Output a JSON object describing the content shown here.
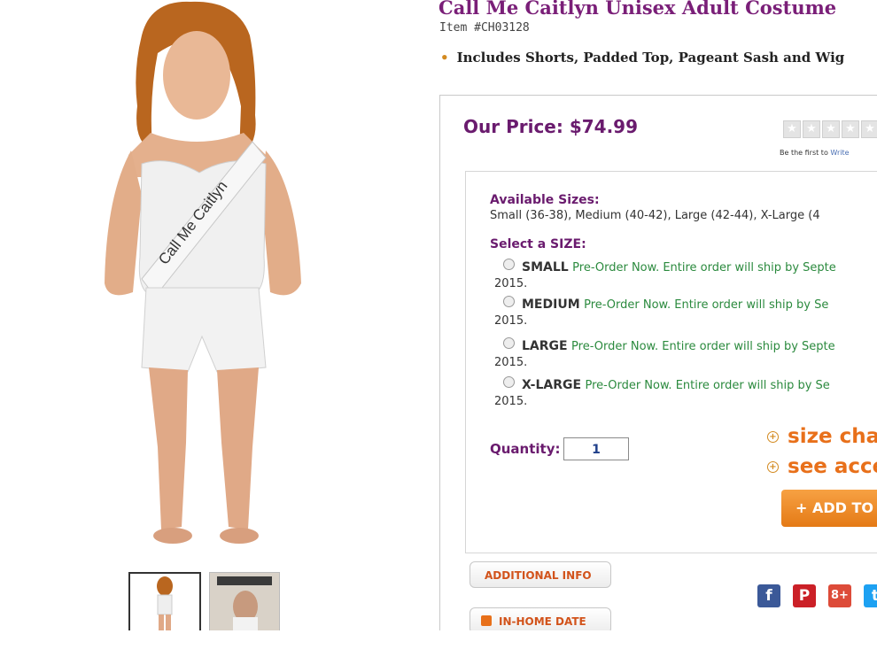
{
  "product": {
    "title": "Call Me Caitlyn Unisex Adult Costume",
    "item_number": "Item #CH03128",
    "feature": "Includes Shorts, Padded Top, Pageant Sash and Wig",
    "sash_text": "Call Me Caitlyn"
  },
  "price": {
    "label": "Our Price: $74.99"
  },
  "rating": {
    "stars": 5,
    "filled": 0,
    "review_prompt": "Be the first to",
    "review_link": "Write"
  },
  "sizes": {
    "heading": "Available Sizes:",
    "list": "Small (36-38), Medium (40-42), Large (42-44), X-Large (4",
    "select_heading": "Select a SIZE:",
    "options": [
      {
        "name": "SMALL",
        "note": "Pre-Order Now. Entire order will ship by Septe",
        "year": "2015."
      },
      {
        "name": "MEDIUM",
        "note": "Pre-Order Now. Entire order will ship by Se",
        "year": "2015."
      },
      {
        "name": "LARGE",
        "note": "Pre-Order Now. Entire order will ship by Septe",
        "year": "2015."
      },
      {
        "name": "X-LARGE",
        "note": "Pre-Order Now. Entire order will ship by Se",
        "year": "2015."
      }
    ]
  },
  "quantity": {
    "label": "Quantity:",
    "value": "1"
  },
  "links": {
    "size_chart": "size char",
    "accessories": "see acce"
  },
  "buttons": {
    "add_to_cart": "+ ADD TO",
    "additional_info": "ADDITIONAL INFO",
    "in_home_date": "IN-HOME DATE"
  },
  "social": {
    "facebook": "f",
    "pinterest": "P",
    "googleplus": "8+",
    "twitter": "t"
  },
  "colors": {
    "title": "#7a1f78",
    "accent": "#e8701a",
    "green": "#2b8a3e"
  }
}
